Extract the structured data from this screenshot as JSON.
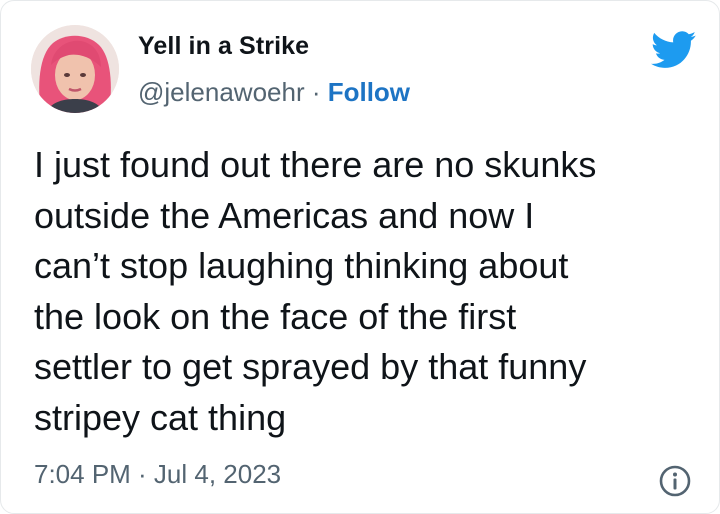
{
  "author": {
    "display_name": "Yell in a Strike",
    "handle": "@jelenawoehr",
    "separator": " · ",
    "follow_label": "Follow"
  },
  "tweet": {
    "text": "I just found out there are no skunks\noutside the Americas and now I\ncan’t stop laughing thinking about\nthe look on the face of the first\nsettler to get sprayed by that funny\nstripey cat thing",
    "timestamp": "7:04 PM · Jul 4, 2023"
  },
  "icons": {
    "brand": "twitter-bird-icon",
    "info": "info-icon"
  },
  "colors": {
    "twitter_blue": "#1d9bf0",
    "follow_blue": "#1d74c4",
    "text_primary": "#0f1419",
    "text_secondary": "#536471",
    "avatar_hair": "#e8537a"
  }
}
